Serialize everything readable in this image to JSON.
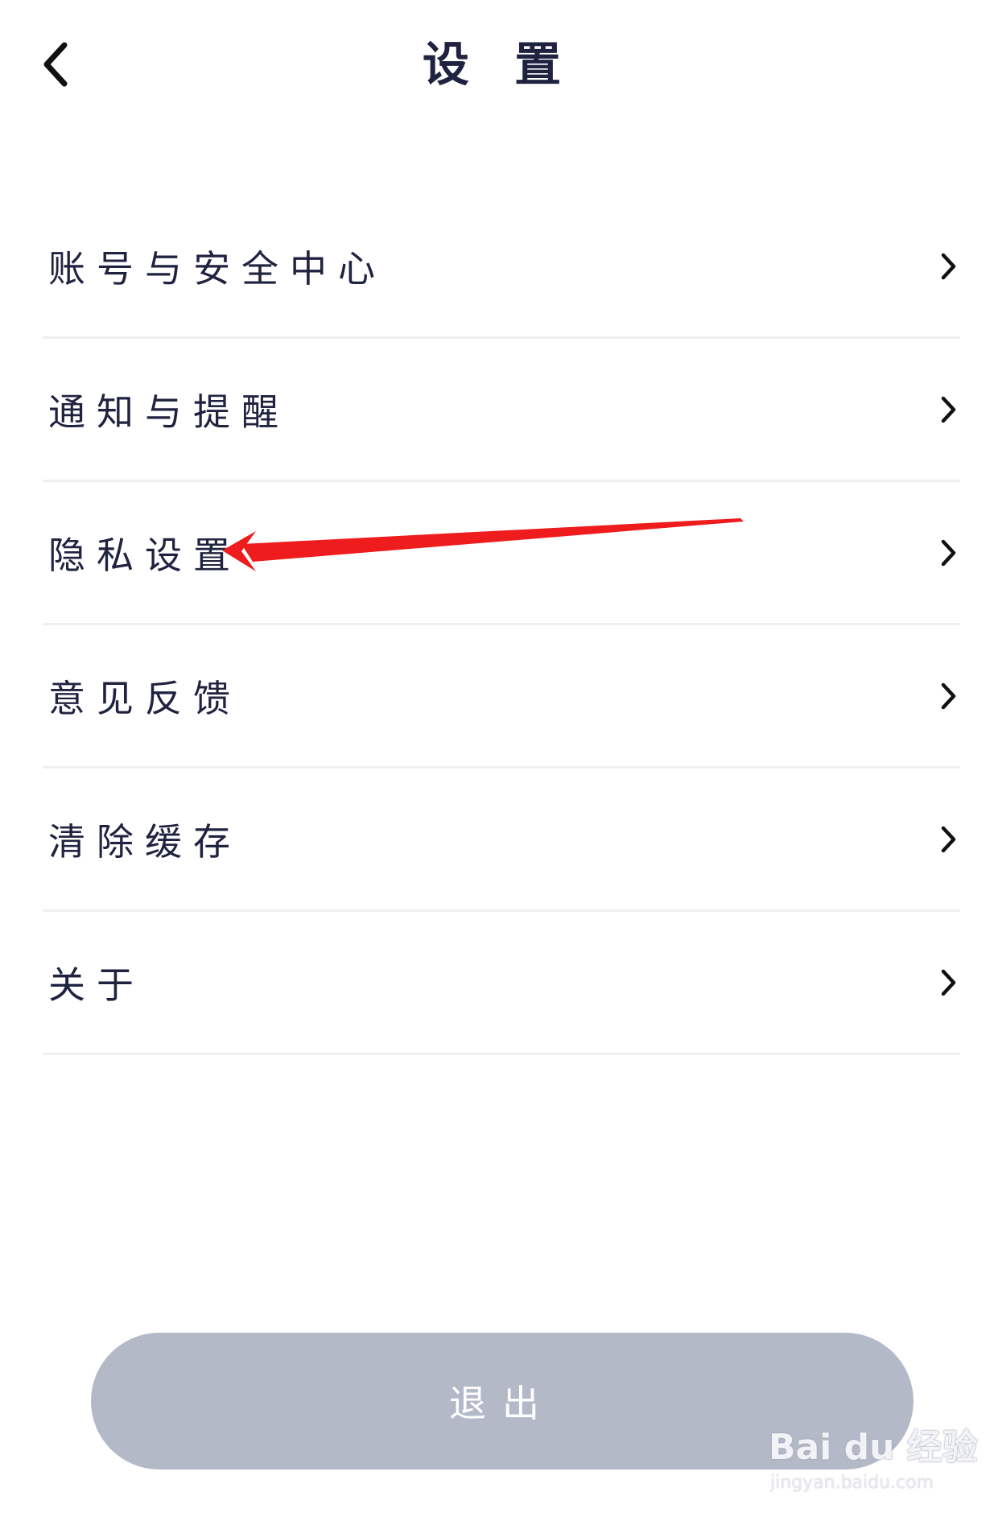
{
  "header": {
    "title": "设 置",
    "back_icon": "chevron-left-icon"
  },
  "menu": {
    "items": [
      {
        "label": "账号与安全中心",
        "icon": "chevron-right-icon"
      },
      {
        "label": "通知与提醒",
        "icon": "chevron-right-icon"
      },
      {
        "label": "隐私设置",
        "icon": "chevron-right-icon"
      },
      {
        "label": "意见反馈",
        "icon": "chevron-right-icon"
      },
      {
        "label": "清除缓存",
        "icon": "chevron-right-icon"
      },
      {
        "label": "关于",
        "icon": "chevron-right-icon"
      }
    ]
  },
  "annotation": {
    "type": "red-arrow",
    "target": "隐私设置",
    "color": "#ee1c1c"
  },
  "footer": {
    "logout_label": "退出",
    "button_color": "#b4b9c8"
  },
  "watermark": {
    "logo": "Bai du 经验",
    "url": "jingyan.baidu.com"
  }
}
